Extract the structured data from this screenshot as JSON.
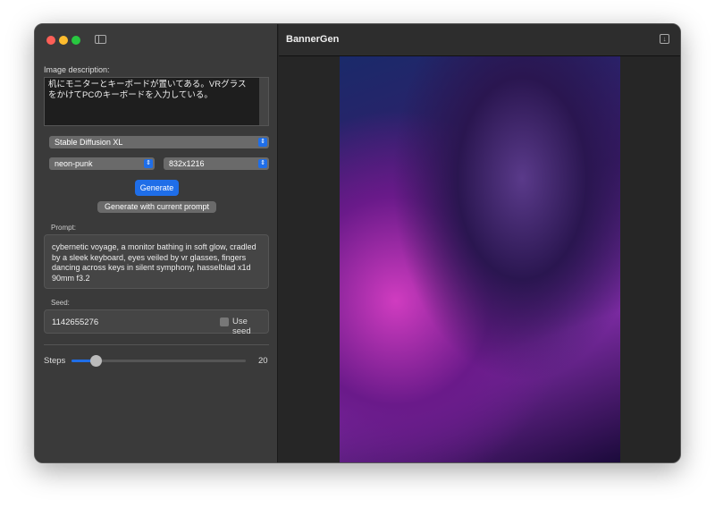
{
  "window": {
    "title": "BannerGen"
  },
  "sidebar": {
    "description_label": "Image description:",
    "description_value": "机にモニターとキーボードが置いてある。VRグラスをかけてPCのキーボードを入力している。",
    "model": "Stable Diffusion XL",
    "style": "neon-punk",
    "size": "832x1216",
    "generate_label": "Generate",
    "generate_current_label": "Generate with current prompt",
    "prompt_label": "Prompt:",
    "prompt_value": "cybernetic voyage, a monitor bathing in soft glow, cradled by a sleek keyboard, eyes veiled by vr glasses, fingers dancing across keys in silent symphony, hasselblad x1d 90mm f3.2",
    "seed_label": "Seed:",
    "seed_value": "1142655276",
    "use_seed_label": "Use seed",
    "use_seed_checked": false,
    "steps_label": "Steps",
    "steps_value": "20",
    "steps_fraction": 0.14
  },
  "colors": {
    "accent": "#1f6ee8"
  }
}
